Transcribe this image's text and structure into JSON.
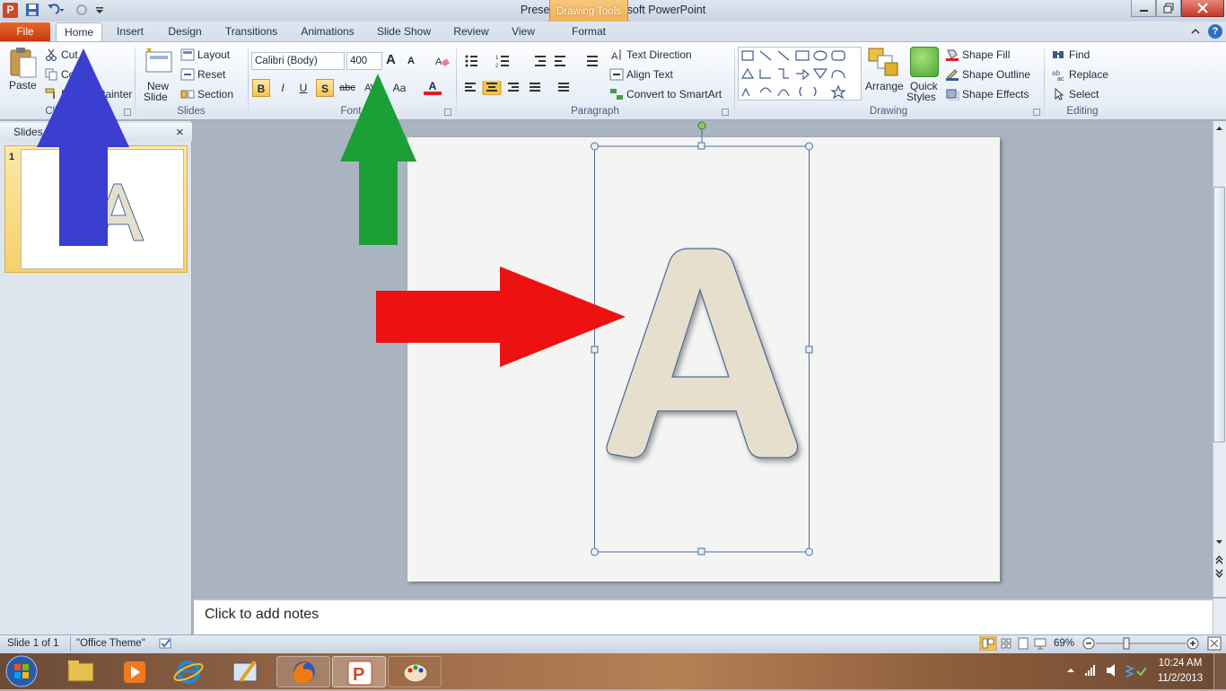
{
  "window": {
    "title": "Presentation1 - Microsoft PowerPoint",
    "context_tab_group": "Drawing Tools"
  },
  "tabs": [
    "File",
    "Home",
    "Insert",
    "Design",
    "Transitions",
    "Animations",
    "Slide Show",
    "Review",
    "View",
    "Format"
  ],
  "ribbon": {
    "clipboard": {
      "paste": "Paste",
      "cut": "Cut",
      "copy": "Copy",
      "format_painter": "Format Painter",
      "label": "Clipboard"
    },
    "slides": {
      "new_slide_1": "New",
      "new_slide_2": "Slide",
      "layout": "Layout",
      "reset": "Reset",
      "section": "Section",
      "label": "Slides"
    },
    "font": {
      "name": "Calibri (Body)",
      "size": "400",
      "label": "Font",
      "bold": "B",
      "italic": "I",
      "underline": "U",
      "shadow": "S",
      "strike": "abc",
      "spacing": "AV",
      "case": "Aa",
      "grow": "A",
      "shrink": "A",
      "color": "A"
    },
    "paragraph": {
      "text_direction": "Text Direction",
      "align_text": "Align Text",
      "convert_smartart": "Convert to SmartArt",
      "label": "Paragraph"
    },
    "drawing": {
      "arrange": "Arrange",
      "quick_styles_1": "Quick",
      "quick_styles_2": "Styles",
      "shape_fill": "Shape Fill",
      "shape_outline": "Shape Outline",
      "shape_effects": "Shape Effects",
      "label": "Drawing"
    },
    "editing": {
      "find": "Find",
      "replace": "Replace",
      "select": "Select",
      "label": "Editing"
    }
  },
  "slides_pane": {
    "tab": "Slides",
    "slide_number": "1",
    "close": "×"
  },
  "slide": {
    "big_letter": "A"
  },
  "notes": {
    "placeholder": "Click to add notes"
  },
  "status": {
    "slide_info": "Slide 1 of 1",
    "theme": "\"Office Theme\"",
    "zoom": "69%"
  },
  "tray": {
    "time": "10:24 AM",
    "date": "11/2/2013"
  },
  "colors": {
    "arrow_blue": "#3a3fcf",
    "arrow_green": "#1c9f35",
    "arrow_red": "#ee1111",
    "letter_fill": "#e6dfcd",
    "letter_outline": "#4a6a9a",
    "accent_file": "#d2461b"
  }
}
